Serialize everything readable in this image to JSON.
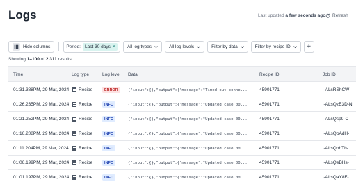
{
  "header": {
    "title": "Logs",
    "updated_prefix": "Last updated",
    "updated_value": "a few seconds ago",
    "refresh_label": "Refresh"
  },
  "toolbar": {
    "hide_columns_label": "Hide columns",
    "period_label": "Period:",
    "period_value": "Last 30 days",
    "filters": [
      "All log types",
      "All log levels",
      "Filter by data",
      "Filter by recipe ID"
    ],
    "add_label": "+"
  },
  "summary": {
    "prefix": "Showing ",
    "range": "1–100",
    "of": " of ",
    "total": "2,311",
    "suffix": " results"
  },
  "table": {
    "columns": [
      "Time",
      "Log type",
      "Log level",
      "Data",
      "Recipe ID",
      "Job ID"
    ],
    "rows": [
      {
        "time": "01:31.388PM, 29 Mar, 2024",
        "type": "Recipe",
        "level": "ERROR",
        "data": "{\"input\":{},\"output\":{\"message\":\"Timed out conne...",
        "recipe_id": "45901771",
        "job_id": "j-ALsRShCW-"
      },
      {
        "time": "01:26.235PM, 29 Mar, 2024",
        "type": "Recipe",
        "level": "INFO",
        "data": "{\"input\":{},\"output\":{\"message\":\"Updated case 00...",
        "recipe_id": "45901771",
        "job_id": "j-ALsQzE3D-N"
      },
      {
        "time": "01:21.252PM, 29 Mar, 2024",
        "type": "Recipe",
        "level": "INFO",
        "data": "{\"input\":{},\"output\":{\"message\":\"Updated case 00...",
        "recipe_id": "45901771",
        "job_id": "j-ALsQsp9-C"
      },
      {
        "time": "01:16.208PM, 29 Mar, 2024",
        "type": "Recipe",
        "level": "INFO",
        "data": "{\"input\":{},\"output\":{\"message\":\"Updated case 00...",
        "recipe_id": "45901771",
        "job_id": "j-ALsQoAdH-"
      },
      {
        "time": "01:11.204PM, 29 Mar, 2024",
        "type": "Recipe",
        "level": "INFO",
        "data": "{\"input\":{},\"output\":{\"message\":\"Updated case 00...",
        "recipe_id": "45901771",
        "job_id": "j-ALsQhbTh-"
      },
      {
        "time": "01:06.199PM, 29 Mar, 2024",
        "type": "Recipe",
        "level": "INFO",
        "data": "{\"input\":{},\"output\":{\"message\":\"Updated case 00...",
        "recipe_id": "45901771",
        "job_id": "j-ALsQeBHs-"
      },
      {
        "time": "01:01.197PM, 29 Mar, 2024",
        "type": "Recipe",
        "level": "INFO",
        "data": "{\"input\":{},\"output\":{\"message\":\"Updated case 00...",
        "recipe_id": "45901771",
        "job_id": "j-ALsQaY8F-"
      }
    ]
  },
  "colors": {
    "chip_bg": "#d8f3ef",
    "info_badge_bg": "#e0ecff",
    "error_badge_bg": "#fde2e2",
    "header_bg": "#f3f4f6"
  },
  "icons": {
    "refresh": "refresh-icon",
    "columns": "columns-icon",
    "recipe": "recipe-icon",
    "caret": "chevron-down-icon"
  }
}
